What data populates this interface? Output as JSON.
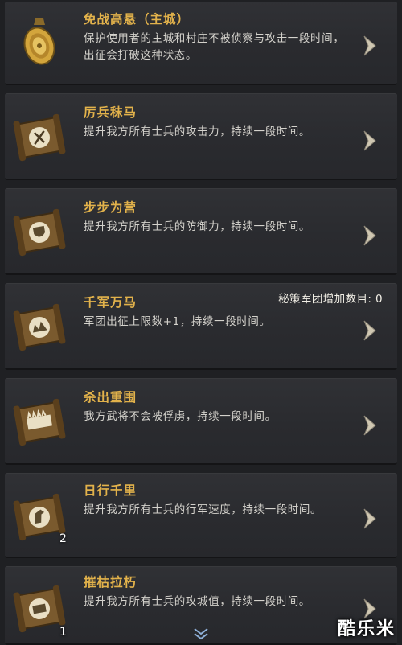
{
  "items": [
    {
      "title": "免战高悬（主城）",
      "desc": "保护使用者的主城和村庄不被侦察与攻击一段时间，出征会打破这种状态。",
      "icon": "gold-medal-icon",
      "count": "",
      "extra": ""
    },
    {
      "title": "厉兵秣马",
      "desc": "提升我方所有士兵的攻击力，持续一段时间。",
      "icon": "scroll-sword-icon",
      "count": "",
      "extra": ""
    },
    {
      "title": "步步为营",
      "desc": "提升我方所有士兵的防御力，持续一段时间。",
      "icon": "scroll-shield-icon",
      "count": "",
      "extra": ""
    },
    {
      "title": "千军万马",
      "desc": "军团出征上限数+1，持续一段时间。",
      "icon": "scroll-army-icon",
      "count": "",
      "extra": "秘策军团增加数目: 0"
    },
    {
      "title": "杀出重围",
      "desc": "我方武将不会被俘虏，持续一段时间。",
      "icon": "scroll-breakout-icon",
      "count": "",
      "extra": ""
    },
    {
      "title": "日行千里",
      "desc": "提升我方所有士兵的行军速度，持续一段时间。",
      "icon": "scroll-horse-icon",
      "count": "2",
      "extra": ""
    },
    {
      "title": "摧枯拉朽",
      "desc": "提升我方所有士兵的攻城值，持续一段时间。",
      "icon": "scroll-siege-icon",
      "count": "1",
      "extra": ""
    }
  ],
  "watermark": "酷乐米",
  "colors": {
    "title": "#e2b24b",
    "text": "#d4d2cc",
    "panel": "#2b2c30",
    "background": "#1f2023"
  }
}
